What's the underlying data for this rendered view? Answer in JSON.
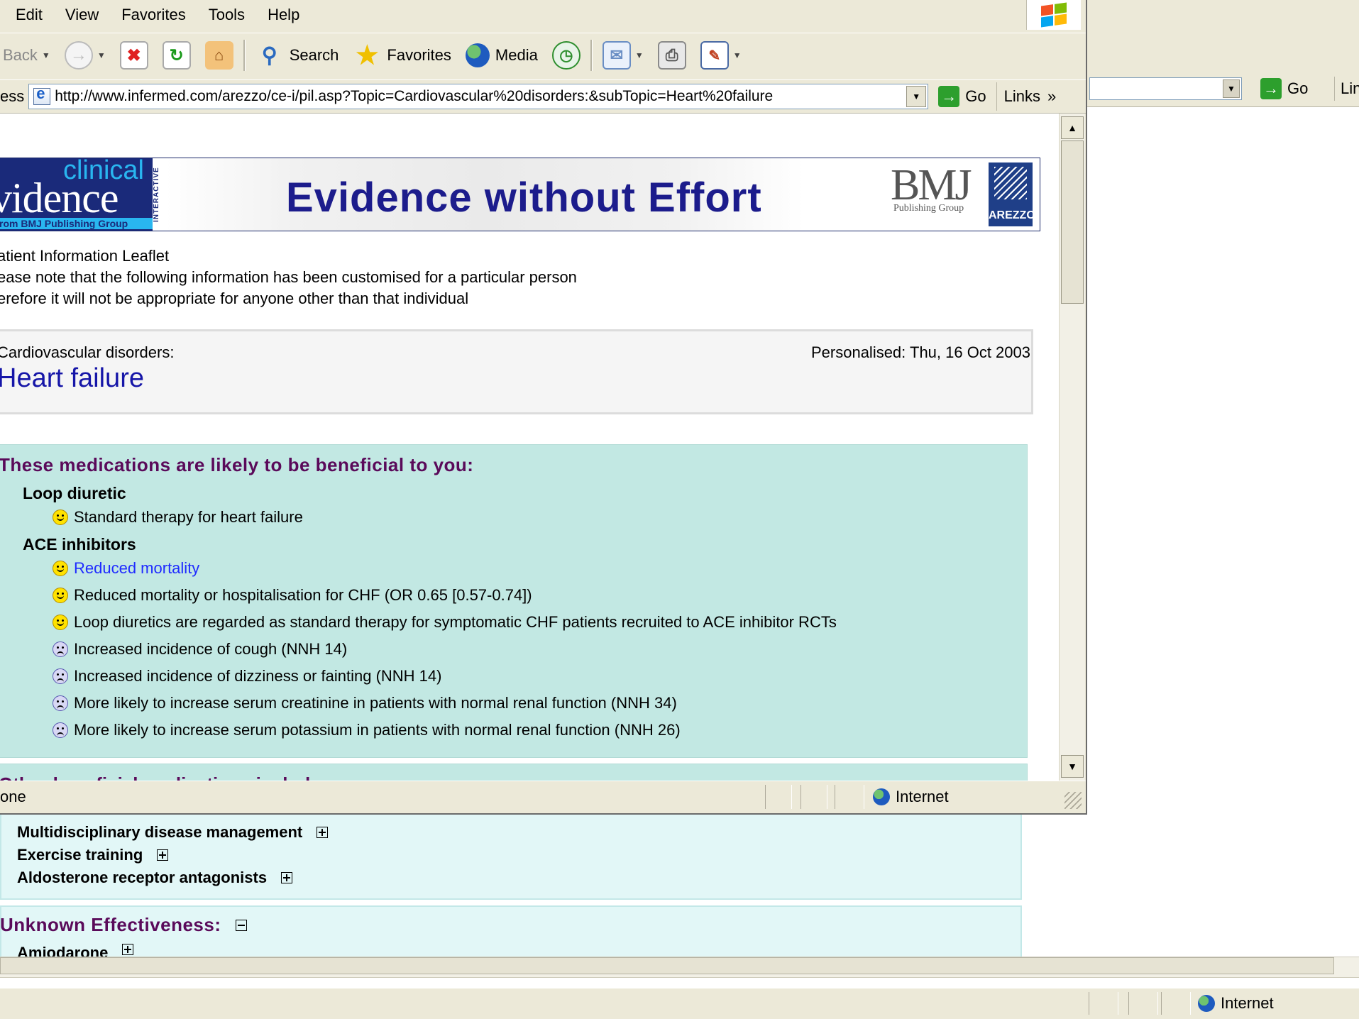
{
  "background_window": {
    "address_go_label": "Go",
    "links_label": "Lin",
    "rows": [
      {
        "label": "Multidisciplinary disease management"
      },
      {
        "label": "Exercise training"
      },
      {
        "label": "Aldosterone receptor antagonists"
      }
    ],
    "unknown_heading": "Unknown Effectiveness:",
    "amiodarone_label": "Amiodarone",
    "status_zone": "Internet"
  },
  "browser": {
    "menu": [
      "Edit",
      "View",
      "Favorites",
      "Tools",
      "Help"
    ],
    "toolbar": {
      "back_label": "Back",
      "search_label": "Search",
      "favorites_label": "Favorites",
      "media_label": "Media"
    },
    "address": {
      "label": "ess",
      "url": "http://www.infermed.com/arezzo/ce-i/pil.asp?Topic=Cardiovascular%20disorders:&subTopic=Heart%20failure",
      "go_label": "Go",
      "links_label": "Links"
    },
    "status": {
      "text": "one",
      "zone": "Internet"
    }
  },
  "page": {
    "banner": {
      "logo_clinical": "clinical",
      "logo_evidence": "vidence",
      "logo_sub": "rom BMJ Publishing Group",
      "logo_interactive": "INTERACTIVE",
      "title": "Evidence without Effort",
      "bmj": "BMJ",
      "bmj_sub": "Publishing Group",
      "arezzo": "AREZZO"
    },
    "intro_lines": [
      "atient Information Leaflet",
      "ease note that the following information has been customised for a particular person",
      "erefore it will not be appropriate for anyone other than that individual"
    ],
    "topic": {
      "category": "Cardiovascular disorders:",
      "personalised": "Personalised: Thu, 16 Oct 2003",
      "title": "Heart failure"
    },
    "medications": {
      "heading": "These medications are likely to be beneficial to you:",
      "groups": [
        {
          "name": "Loop diuretic",
          "items": [
            {
              "text": "Standard therapy for heart failure",
              "icon": "happy-face"
            }
          ]
        },
        {
          "name": "ACE inhibitors",
          "items": [
            {
              "text": "Reduced mortality",
              "icon": "happy-face"
            },
            {
              "text": "Reduced mortality or hospitalisation for CHF (OR 0.65 [0.57-0.74])",
              "icon": "happy-face"
            },
            {
              "text": "Loop diuretics are regarded as standard therapy for symptomatic CHF patients recruited to ACE inhibitor RCTs",
              "icon": "happy-face"
            },
            {
              "text": "Increased incidence of cough (NNH 14)",
              "icon": "sad-face"
            },
            {
              "text": "Increased incidence of dizziness or fainting (NNH 14)",
              "icon": "sad-face"
            },
            {
              "text": "More likely to increase serum creatinine in patients with normal renal function (NNH 34)",
              "icon": "sad-face"
            },
            {
              "text": "More likely to increase serum potassium in patients with normal renal function (NNH 26)",
              "icon": "sad-face"
            }
          ]
        }
      ]
    },
    "next_heading": "Other beneficial medications include:"
  },
  "colors": {
    "chrome": "#ece9d8",
    "panel": "#c2e8e3",
    "heading": "#5a0a5a",
    "title_blue": "#1616a8",
    "link": "#1f2bff"
  }
}
